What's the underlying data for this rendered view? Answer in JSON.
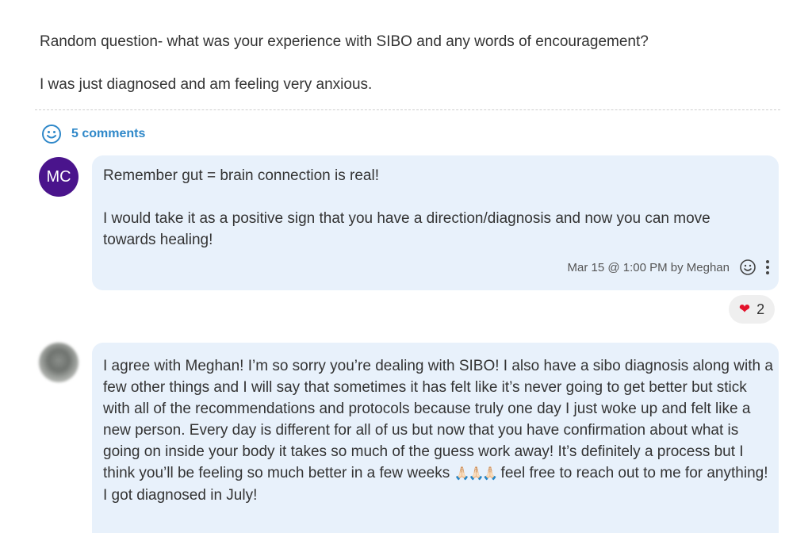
{
  "post": {
    "line1": "Random question- what was your experience with SIBO and any words of encouragement?",
    "line2": "I was just diagnosed and am feeling very anxious."
  },
  "comments_header": {
    "count_label": "5 comments",
    "icon": "smiley-icon"
  },
  "comments": [
    {
      "avatar_initials": "MC",
      "avatar_color": "#4a148c",
      "line1": "Remember gut = brain connection is real!",
      "para2": "I would take it as a positive sign that you have a direction/diagnosis and now you can move towards healing!",
      "meta": "Mar 15 @ 1:00 PM by Meghan",
      "reaction": {
        "emoji": "❤",
        "count": "2"
      }
    },
    {
      "avatar": "blurred-photo",
      "text_before": "I agree with Meghan! I’m so sorry you’re dealing with SIBO! I also have a sibo diagnosis along with a few other things and I will say that sometimes it has felt like it’s never going to get better but stick with all of the recommendations and protocols because truly one day I just woke up and felt like a new person. Every day is different for all of us but now that you have confirmation about what is going on inside your body it takes so much of the guess work away! It’s definitely a process but I think you’ll be feeling so much better in a few weeks",
      "emoji": "🙏🏻🙏🏻🙏🏻",
      "text_after": " feel free to reach out to me for anything! I got diagnosed in July!"
    }
  ],
  "colors": {
    "accent": "#2f88c9",
    "bubble": "#e8f1fb",
    "avatar": "#4a148c"
  }
}
